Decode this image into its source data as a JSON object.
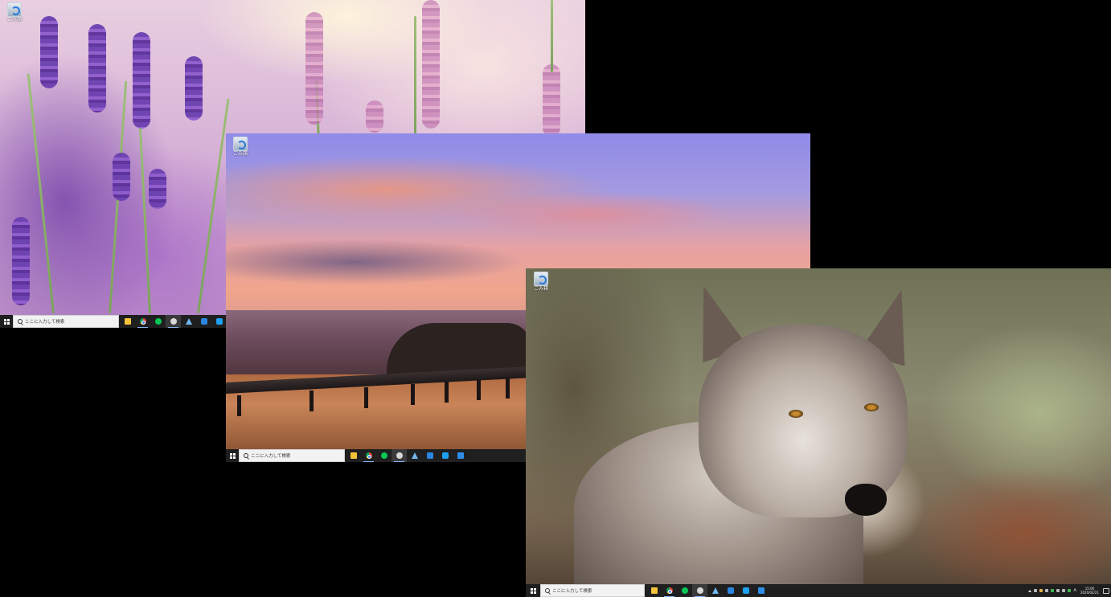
{
  "monitors": [
    {
      "id": "monitor-1",
      "wallpaper": "lavender-field",
      "desktop_icon": {
        "name": "recycle-bin",
        "label": "ごみ箱"
      },
      "taskbar": {
        "search_placeholder": "ここに入力して検索",
        "pinned_apps": [
          "file-explorer",
          "chrome",
          "line",
          "cloud-app",
          "navigation-app",
          "app-launcher",
          "twitter"
        ]
      }
    },
    {
      "id": "monitor-2",
      "wallpaper": "ocean-sunset",
      "desktop_icon": {
        "name": "recycle-bin",
        "label": "ごみ箱"
      },
      "taskbar": {
        "search_placeholder": "ここに入力して検索",
        "pinned_apps": [
          "file-explorer",
          "chrome",
          "line",
          "cloud-app",
          "navigation-app",
          "app-launcher",
          "twitter",
          "app-window"
        ]
      }
    },
    {
      "id": "monitor-3",
      "wallpaper": "gray-wolf",
      "desktop_icon": {
        "name": "recycle-bin",
        "label": "ごみ箱"
      },
      "taskbar": {
        "search_placeholder": "ここに入力して検索",
        "pinned_apps": [
          "file-explorer",
          "chrome",
          "line",
          "cloud-app",
          "navigation-app",
          "app-launcher",
          "twitter",
          "app-window"
        ],
        "tray": {
          "ime": "A",
          "time": "15:00",
          "date": "2020/02/21"
        }
      }
    }
  ],
  "colors": {
    "taskbar_bg": "#1f1f1f",
    "search_bg": "#f2f2f2",
    "desktop_bg": "#000000"
  }
}
